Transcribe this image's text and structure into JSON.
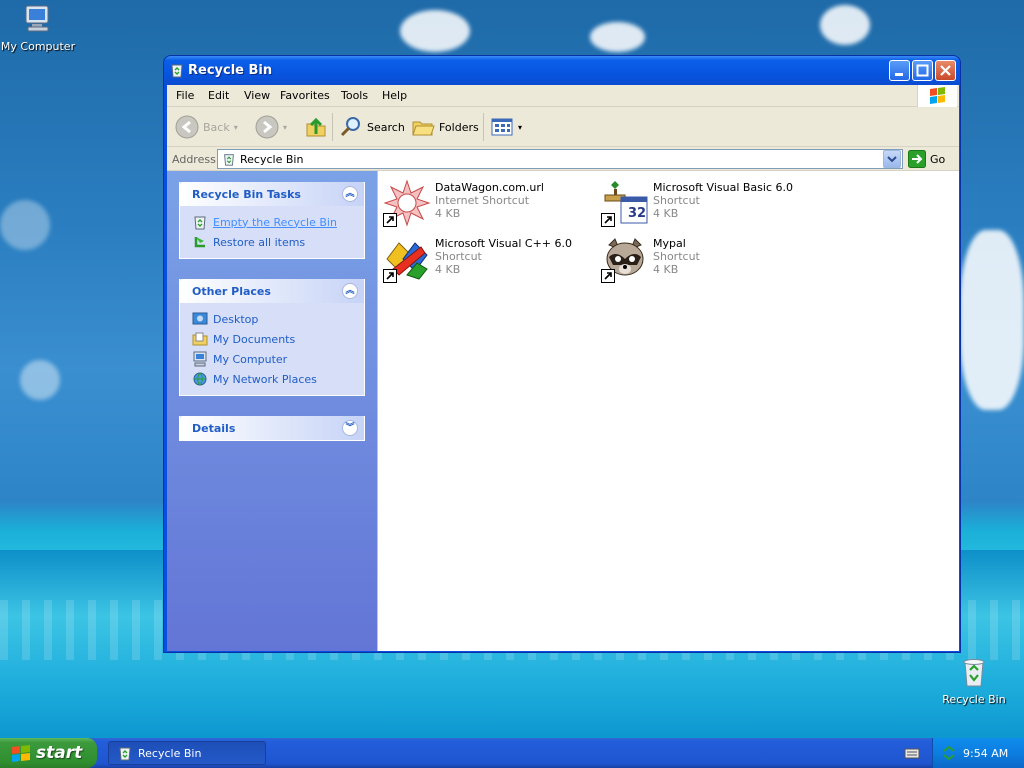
{
  "desktop": {
    "icons": [
      {
        "label": "My Computer"
      },
      {
        "label": "Recycle Bin"
      }
    ]
  },
  "window": {
    "title": "Recycle Bin",
    "menu": [
      "File",
      "Edit",
      "View",
      "Favorites",
      "Tools",
      "Help"
    ],
    "toolbar": {
      "back_label": "Back",
      "search_label": "Search",
      "folders_label": "Folders"
    },
    "address": {
      "label": "Address",
      "value": "Recycle Bin",
      "go_label": "Go"
    },
    "taskpane": {
      "tasks": {
        "title": "Recycle Bin Tasks",
        "items": [
          "Empty the Recycle Bin",
          "Restore all items"
        ]
      },
      "places": {
        "title": "Other Places",
        "items": [
          "Desktop",
          "My Documents",
          "My Computer",
          "My Network Places"
        ]
      },
      "details": {
        "title": "Details"
      }
    },
    "files": [
      {
        "name": "DataWagon.com.url",
        "type": "Internet Shortcut",
        "size": "4 KB",
        "icon": "datawagon-url-icon"
      },
      {
        "name": "Microsoft Visual Basic 6.0",
        "type": "Shortcut",
        "size": "4 KB",
        "icon": "visual-basic-icon"
      },
      {
        "name": "Microsoft Visual C++ 6.0",
        "type": "Shortcut",
        "size": "4 KB",
        "icon": "visual-cpp-icon"
      },
      {
        "name": "Mypal",
        "type": "Shortcut",
        "size": "4 KB",
        "icon": "mypal-raccoon-icon"
      }
    ]
  },
  "taskbar": {
    "start_label": "start",
    "task_item_label": "Recycle Bin",
    "clock": "9:54 AM"
  },
  "colors": {
    "titlebar": "#0855e0",
    "taskpane_link": "#215dc6",
    "start_green": "#3c9a3c"
  }
}
